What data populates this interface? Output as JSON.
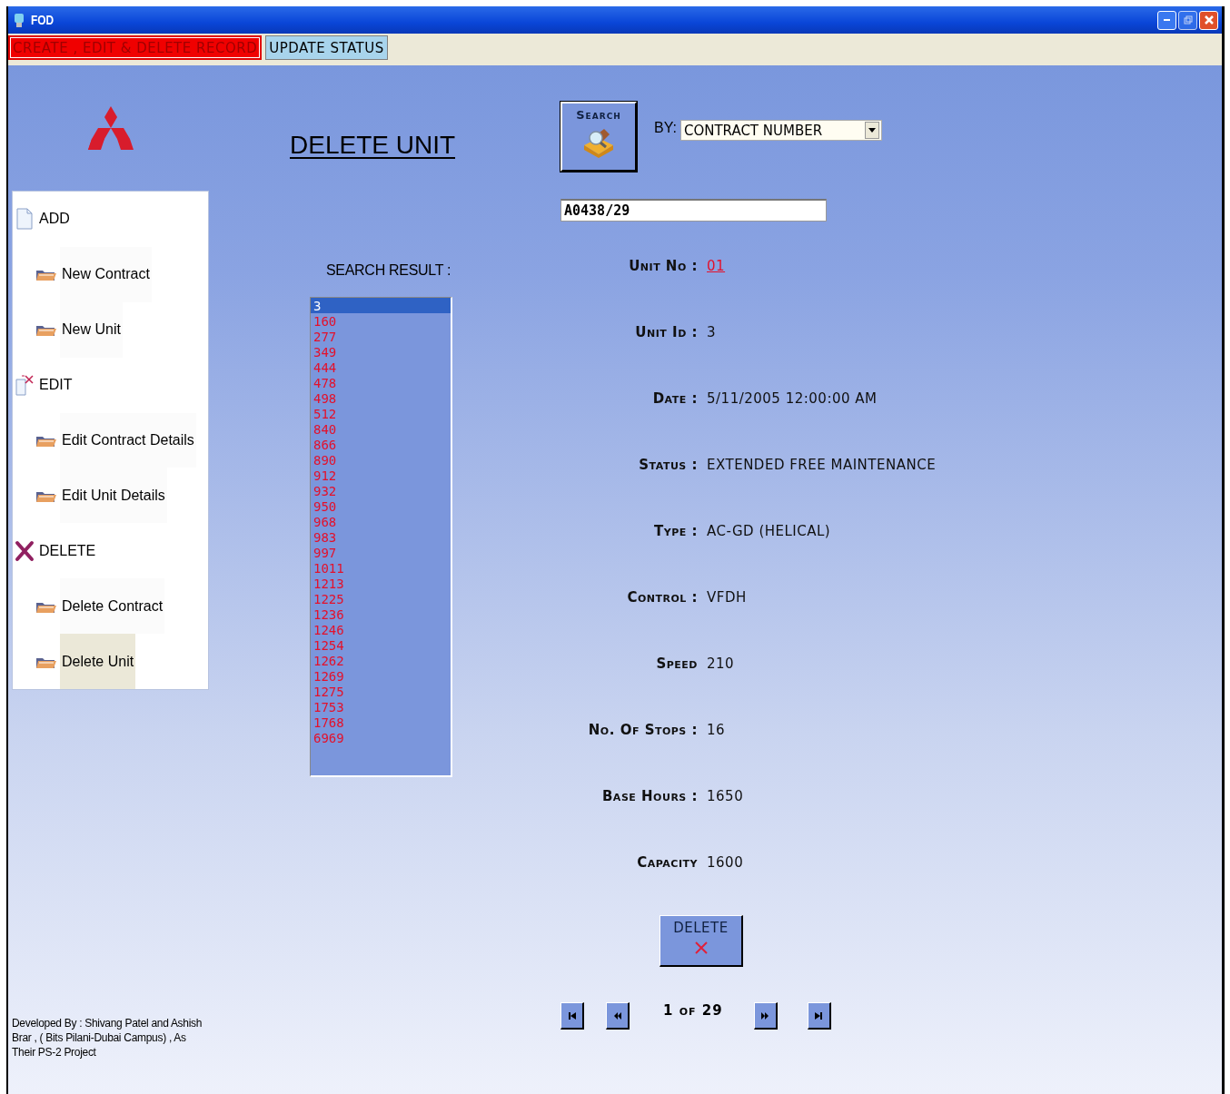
{
  "window": {
    "title": "FOD"
  },
  "tabs": [
    {
      "label": "CREATE , EDIT & DELETE RECORD",
      "selected": true
    },
    {
      "label": "UPDATE STATUS",
      "selected": false
    }
  ],
  "page_title": "DELETE UNIT",
  "sidebar": {
    "sections": [
      {
        "label": "ADD",
        "children": [
          {
            "label": "New Contract",
            "selected": false
          },
          {
            "label": "New Unit",
            "selected": false
          }
        ]
      },
      {
        "label": "EDIT",
        "children": [
          {
            "label": "Edit Contract Details",
            "selected": false
          },
          {
            "label": "Edit Unit Details",
            "selected": false
          }
        ]
      },
      {
        "label": "DELETE",
        "children": [
          {
            "label": "Delete Contract",
            "selected": false
          },
          {
            "label": "Delete Unit",
            "selected": true
          }
        ]
      }
    ]
  },
  "footer": "Developed By : Shivang Patel and Ashish Brar   , ( Bits Pilani-Dubai Campus) , As Their PS-2 Project",
  "search": {
    "button": "Search",
    "by_label": "BY:",
    "by_value": "CONTRACT NUMBER",
    "value": "A0438/29"
  },
  "search_result": {
    "label": "SEARCH RESULT :",
    "items": [
      {
        "label": "3",
        "selected": true
      },
      {
        "label": "160",
        "selected": false
      },
      {
        "label": "277",
        "selected": false
      },
      {
        "label": "349",
        "selected": false
      },
      {
        "label": "444",
        "selected": false
      },
      {
        "label": "478",
        "selected": false
      },
      {
        "label": "498",
        "selected": false
      },
      {
        "label": "512",
        "selected": false
      },
      {
        "label": "840",
        "selected": false
      },
      {
        "label": "866",
        "selected": false
      },
      {
        "label": "890",
        "selected": false
      },
      {
        "label": "912",
        "selected": false
      },
      {
        "label": "932",
        "selected": false
      },
      {
        "label": "950",
        "selected": false
      },
      {
        "label": "968",
        "selected": false
      },
      {
        "label": "983",
        "selected": false
      },
      {
        "label": "997",
        "selected": false
      },
      {
        "label": "1011",
        "selected": false
      },
      {
        "label": "1213",
        "selected": false
      },
      {
        "label": "1225",
        "selected": false
      },
      {
        "label": "1236",
        "selected": false
      },
      {
        "label": "1246",
        "selected": false
      },
      {
        "label": "1254",
        "selected": false
      },
      {
        "label": "1262",
        "selected": false
      },
      {
        "label": "1269",
        "selected": false
      },
      {
        "label": "1275",
        "selected": false
      },
      {
        "label": "1753",
        "selected": false
      },
      {
        "label": "1768",
        "selected": false
      },
      {
        "label": "6969",
        "selected": false
      }
    ]
  },
  "details": [
    {
      "label": "Unit No :",
      "value": "01",
      "kind": "link"
    },
    {
      "label": "Unit Id :",
      "value": "3",
      "kind": "text"
    },
    {
      "label": "Date :",
      "value": "5/11/2005 12:00:00 AM",
      "kind": "text"
    },
    {
      "label": "Status :",
      "value": "EXTENDED FREE MAINTENANCE",
      "kind": "text"
    },
    {
      "label": "Type :",
      "value": "AC-GD (HELICAL)",
      "kind": "text"
    },
    {
      "label": "Control :",
      "value": "VFDH",
      "kind": "text"
    },
    {
      "label": "Speed",
      "value": "210",
      "kind": "text"
    },
    {
      "label": "No. Of Stops :",
      "value": "16",
      "kind": "text"
    },
    {
      "label": "Base Hours :",
      "value": "1650",
      "kind": "text"
    },
    {
      "label": "Capacity",
      "value": "1600",
      "kind": "text"
    }
  ],
  "delete_button": "DELETE",
  "pager": {
    "text": "1 of 29"
  }
}
